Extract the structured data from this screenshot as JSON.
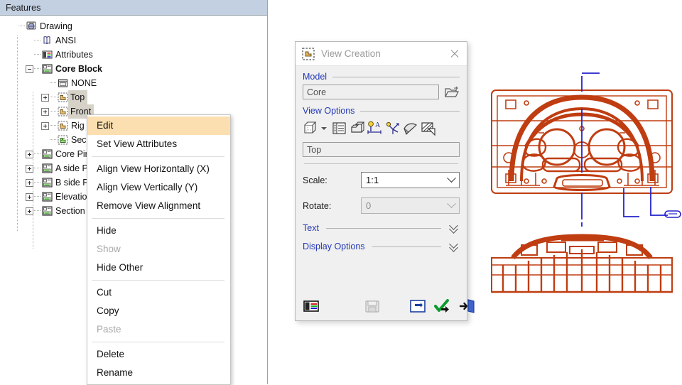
{
  "features_panel": {
    "header": "Features",
    "tree": [
      {
        "label": "Drawing",
        "icon": "drawing-icon",
        "depth": 0,
        "expander": "none",
        "bold": false,
        "selected": false
      },
      {
        "label": "ANSI",
        "icon": "standard-icon",
        "depth": 1,
        "expander": "none",
        "bold": false,
        "selected": false
      },
      {
        "label": "Attributes",
        "icon": "attributes-icon",
        "depth": 1,
        "expander": "none",
        "bold": false,
        "selected": false
      },
      {
        "label": "Core Block",
        "icon": "sheet-icon",
        "depth": 1,
        "expander": "minus",
        "bold": true,
        "selected": false
      },
      {
        "label": "NONE",
        "icon": "none-icon",
        "depth": 2,
        "expander": "none",
        "bold": false,
        "selected": false
      },
      {
        "label": "Top",
        "icon": "view-icon",
        "depth": 2,
        "expander": "plus",
        "bold": false,
        "selected": true
      },
      {
        "label": "Front",
        "icon": "view-icon",
        "depth": 2,
        "expander": "plus",
        "bold": false,
        "selected": true
      },
      {
        "label": "Rig",
        "icon": "view-icon",
        "depth": 2,
        "expander": "plus",
        "bold": false,
        "selected": false
      },
      {
        "label": "Sec",
        "icon": "section-view-icon",
        "depth": 2,
        "expander": "none",
        "bold": false,
        "selected": false
      },
      {
        "label": "Core Pin",
        "icon": "sheet-icon",
        "depth": 1,
        "expander": "plus",
        "bold": false,
        "selected": false
      },
      {
        "label": "A side Pla",
        "icon": "sheet-icon",
        "depth": 1,
        "expander": "plus",
        "bold": false,
        "selected": false
      },
      {
        "label": "B side Pla",
        "icon": "sheet-icon",
        "depth": 1,
        "expander": "plus",
        "bold": false,
        "selected": false
      },
      {
        "label": "Elevation",
        "icon": "sheet-icon",
        "depth": 1,
        "expander": "plus",
        "bold": false,
        "selected": false
      },
      {
        "label": "Section V",
        "icon": "sheet-icon",
        "depth": 1,
        "expander": "plus",
        "bold": false,
        "selected": false
      }
    ]
  },
  "context_menu": {
    "items": [
      {
        "label": "Edit",
        "state": "highlighted",
        "sep_after": false
      },
      {
        "label": "Set View Attributes",
        "state": "normal",
        "sep_after": true
      },
      {
        "label": "Align View Horizontally (X)",
        "state": "normal",
        "sep_after": false
      },
      {
        "label": "Align View Vertically (Y)",
        "state": "normal",
        "sep_after": false
      },
      {
        "label": "Remove View Alignment",
        "state": "normal",
        "sep_after": true
      },
      {
        "label": "Hide",
        "state": "normal",
        "sep_after": false
      },
      {
        "label": "Show",
        "state": "disabled",
        "sep_after": false
      },
      {
        "label": "Hide Other",
        "state": "normal",
        "sep_after": true
      },
      {
        "label": "Cut",
        "state": "normal",
        "sep_after": false
      },
      {
        "label": "Copy",
        "state": "normal",
        "sep_after": false
      },
      {
        "label": "Paste",
        "state": "disabled",
        "sep_after": true
      },
      {
        "label": "Delete",
        "state": "normal",
        "sep_after": false
      },
      {
        "label": "Rename",
        "state": "normal",
        "sep_after": false
      }
    ]
  },
  "view_dialog": {
    "title": "View Creation",
    "close_label": "",
    "model": {
      "group_label": "Model",
      "value": "Core",
      "browse_icon": "open-folder-icon"
    },
    "view_options": {
      "group_label": "View Options",
      "toolbar": [
        {
          "name": "view-orientation-icon"
        },
        {
          "name": "orientation-dropdown-caret"
        },
        {
          "name": "view-list-icon"
        },
        {
          "name": "solid-view-icon"
        },
        {
          "name": "annotation-icon"
        },
        {
          "name": "axis-icon"
        },
        {
          "name": "shade-icon"
        },
        {
          "name": "hatch-icon"
        }
      ],
      "view_name": "Top"
    },
    "scale": {
      "label": "Scale:",
      "value": "1:1",
      "options": [
        "1:1"
      ],
      "enabled": true
    },
    "rotate": {
      "label": "Rotate:",
      "value": "0",
      "options": [
        "0"
      ],
      "enabled": false
    },
    "sections": [
      {
        "label": "Text",
        "expanded": false
      },
      {
        "label": "Display Options",
        "expanded": false
      }
    ],
    "footer": [
      {
        "name": "list-options-icon",
        "enabled": true
      },
      {
        "name": "save-settings-icon",
        "enabled": false
      },
      {
        "name": "reset-icon",
        "enabled": true
      },
      {
        "name": "apply-icon",
        "enabled": true
      },
      {
        "name": "exit-icon",
        "enabled": true
      }
    ]
  },
  "drawing": {
    "top_view_name": "Top",
    "front_view_name": "Front",
    "part_color": "#bf3d11",
    "dimension_color": "#2222cc",
    "accent_color": "#2338b5"
  }
}
